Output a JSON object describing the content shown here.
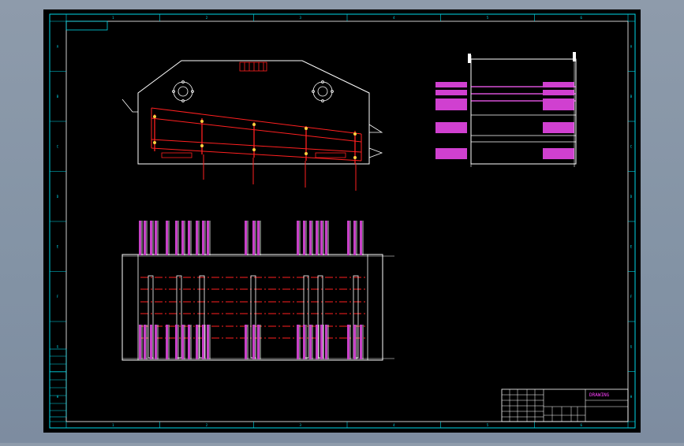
{
  "colors": {
    "background": "#8a97a8",
    "sheet": "#000000",
    "frame": "#00d8e8",
    "outline": "#ffffff",
    "member": "#ff2020",
    "dim_text": "#e040e0",
    "title_text": "#ff40ff"
  },
  "sheet": {
    "col_labels": [
      "1",
      "2",
      "3",
      "4",
      "5",
      "6"
    ],
    "row_labels": [
      "A",
      "B",
      "C",
      "D",
      "E",
      "F",
      "G",
      "H"
    ]
  },
  "title_block": {
    "drawing_title": "DRAWING"
  }
}
